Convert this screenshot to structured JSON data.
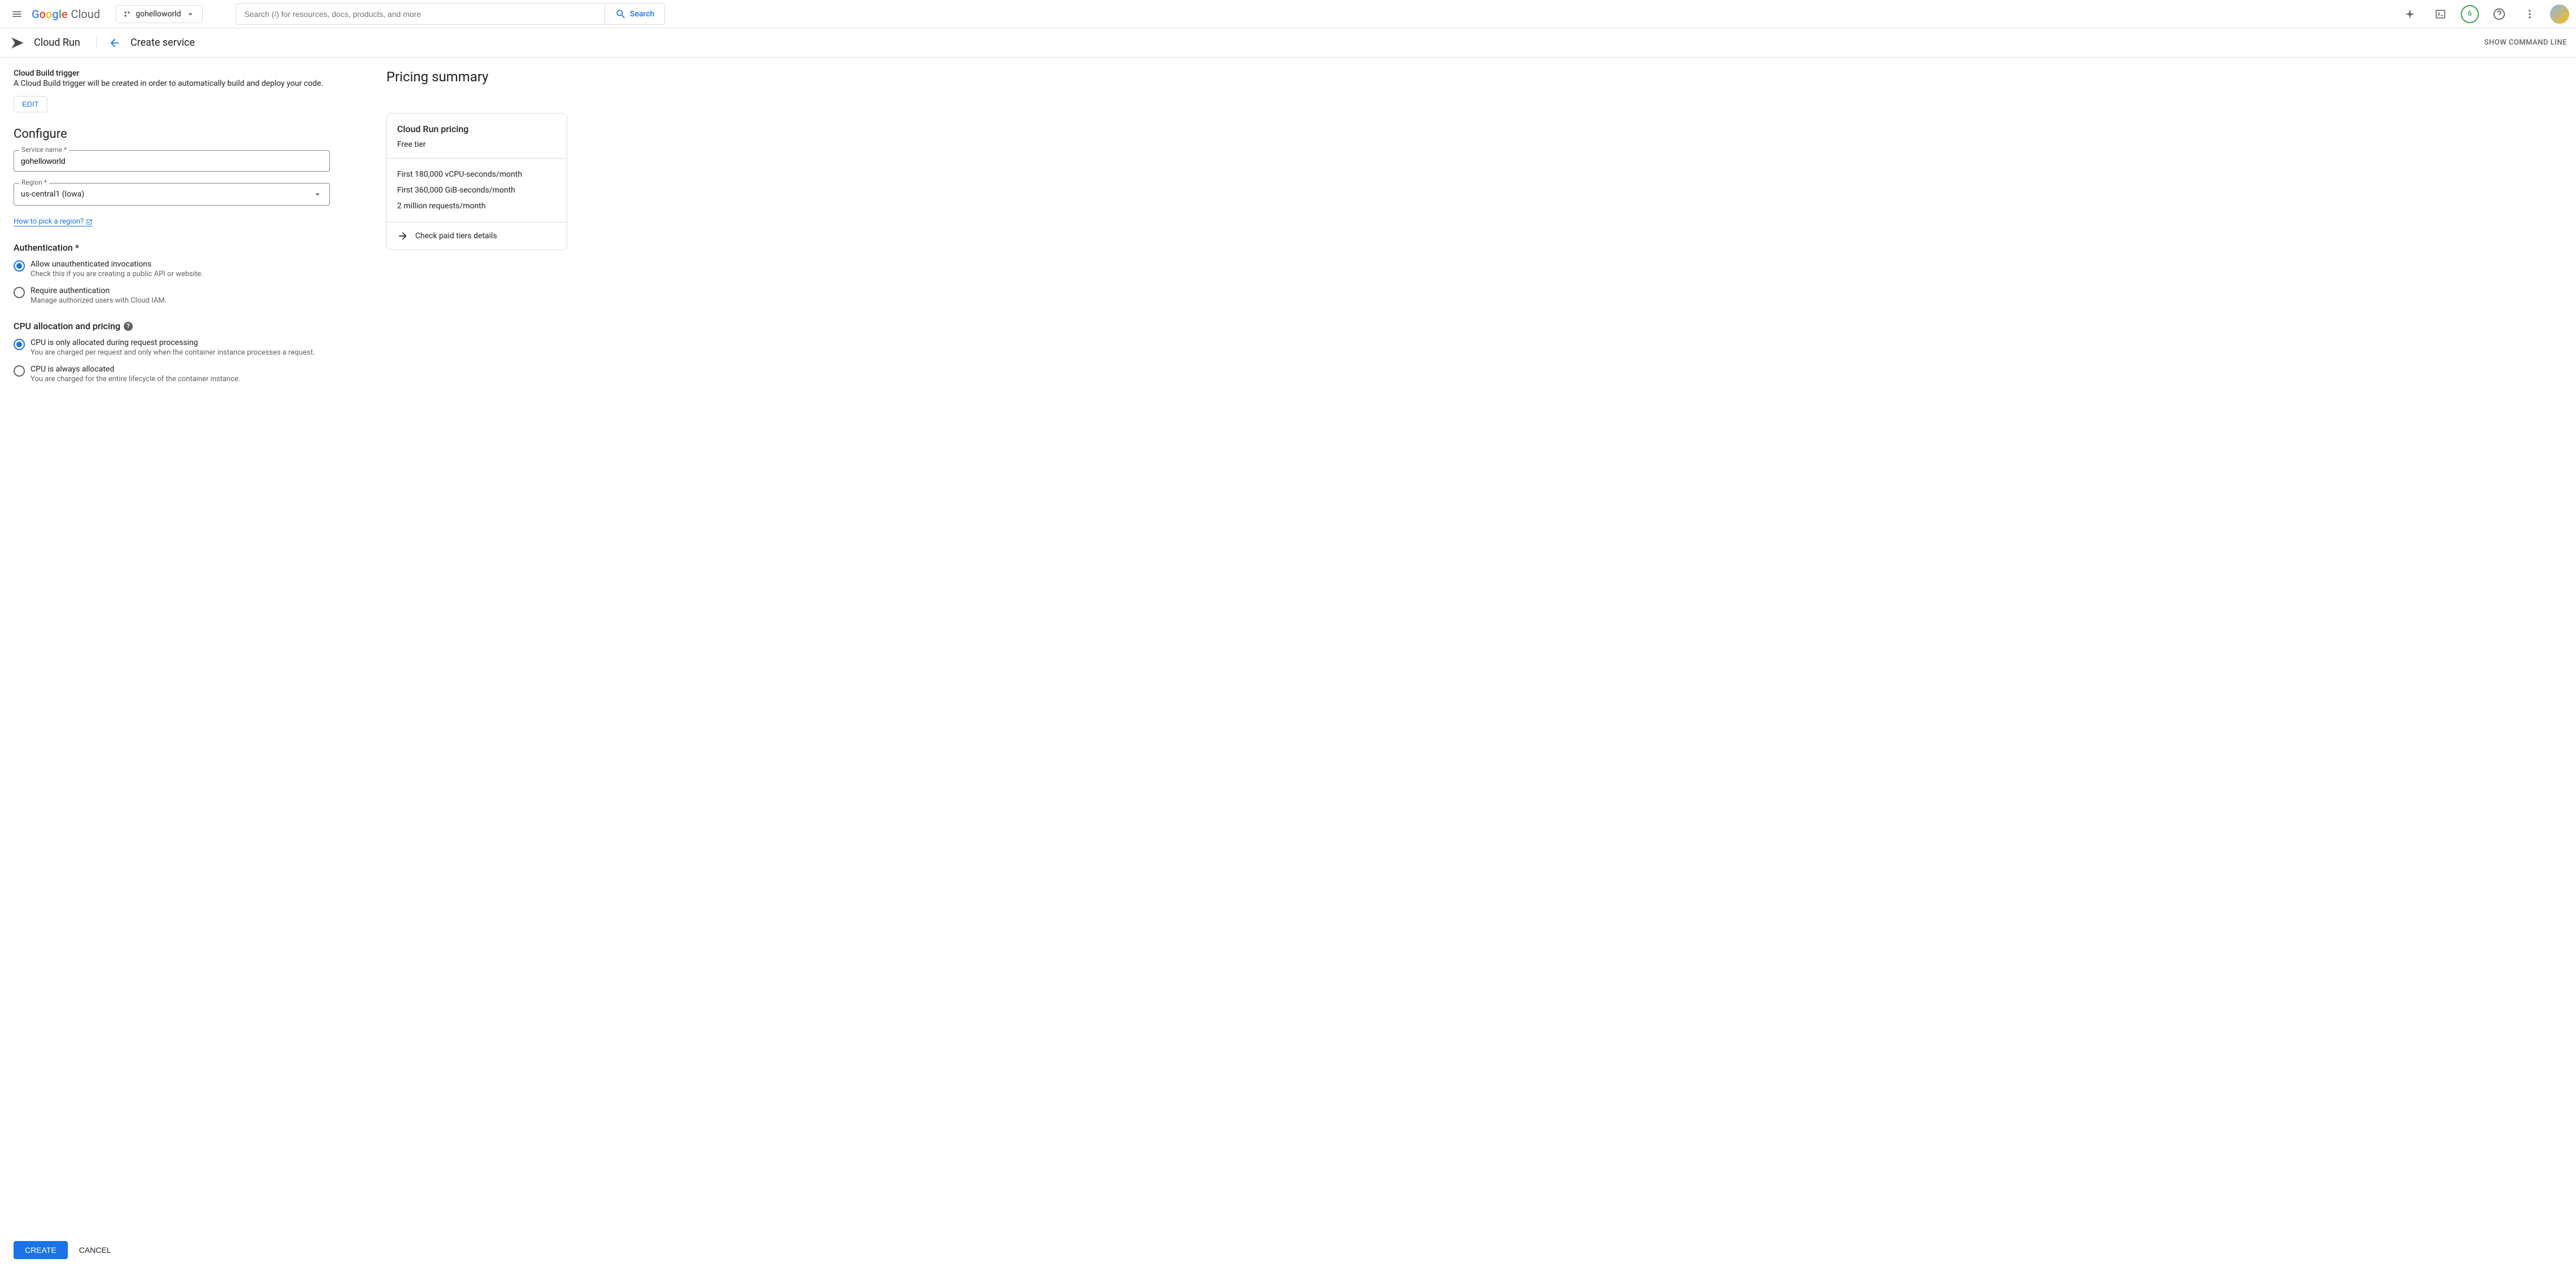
{
  "header": {
    "logo_cloud": "Cloud",
    "project_name": "gohelloworld",
    "search_placeholder": "Search (/) for resources, docs, products, and more",
    "search_button": "Search",
    "trial_count": "6"
  },
  "subheader": {
    "product": "Cloud Run",
    "page_title": "Create service",
    "show_cmd": "SHOW COMMAND LINE"
  },
  "form": {
    "trigger_heading": "Cloud Build trigger",
    "trigger_desc": "A Cloud Build trigger will be created in order to automatically build and deploy your code.",
    "edit": "EDIT",
    "configure": "Configure",
    "service_name_label": "Service name *",
    "service_name_value": "gohelloworld",
    "region_label": "Region *",
    "region_value": "us-central1 (Iowa)",
    "region_help": "How to pick a region?",
    "auth_heading": "Authentication *",
    "auth_allow_label": "Allow unauthenticated invocations",
    "auth_allow_desc": "Check this if you are creating a public API or website.",
    "auth_require_label": "Require authentication",
    "auth_require_desc": "Manage authorized users with Cloud IAM.",
    "cpu_heading": "CPU allocation and pricing",
    "cpu_request_label": "CPU is only allocated during request processing",
    "cpu_request_desc": "You are charged per request and only when the container instance processes a request.",
    "cpu_always_label": "CPU is always allocated",
    "cpu_always_desc": "You are charged for the entire lifecycle of the container instance."
  },
  "pricing": {
    "heading": "Pricing summary",
    "card_title": "Cloud Run pricing",
    "free_tier": "Free tier",
    "items": [
      "First 180,000 vCPU-seconds/month",
      "First 360,000 GiB-seconds/month",
      "2 million requests/month"
    ],
    "details_link": "Check paid tiers details"
  },
  "footer": {
    "create": "CREATE",
    "cancel": "CANCEL"
  }
}
